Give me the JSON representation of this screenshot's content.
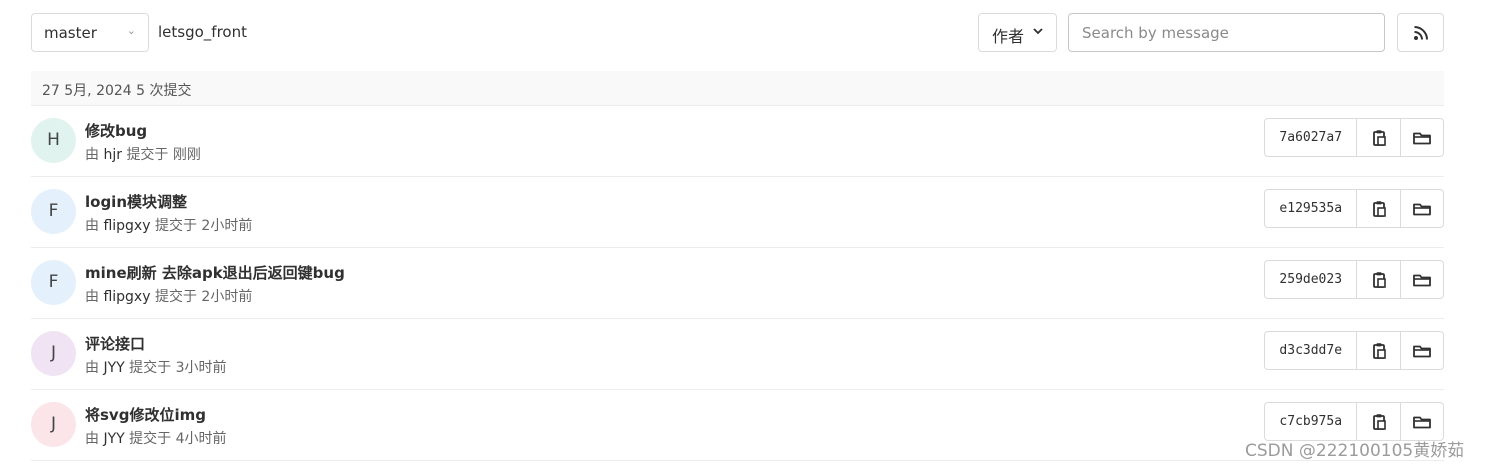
{
  "toolbar": {
    "branch": "master",
    "path": "letsgo_front",
    "author_label": "作者",
    "search_placeholder": "Search by message"
  },
  "day_header": "27 5月, 2024 5 次提交",
  "commits": [
    {
      "initial": "H",
      "avatar_color": "#e0f3ef",
      "title": "修改bug",
      "by": "由",
      "author": "hjr",
      "committed": "提交于",
      "time": "刚刚",
      "sha": "7a6027a7"
    },
    {
      "initial": "F",
      "avatar_color": "#e4f0fb",
      "title": "login模块调整",
      "by": "由",
      "author": "flipgxy",
      "committed": "提交于",
      "time": "2小时前",
      "sha": "e129535a"
    },
    {
      "initial": "F",
      "avatar_color": "#e4f0fb",
      "title": "mine刷新 去除apk退出后返回键bug",
      "by": "由",
      "author": "flipgxy",
      "committed": "提交于",
      "time": "2小时前",
      "sha": "259de023"
    },
    {
      "initial": "J",
      "avatar_color": "#efe3f4",
      "title": "评论接口",
      "by": "由",
      "author": "JYY",
      "committed": "提交于",
      "time": "3小时前",
      "sha": "d3c3dd7e"
    },
    {
      "initial": "J",
      "avatar_color": "#fbe5e8",
      "title": "将svg修改位img",
      "by": "由",
      "author": "JYY",
      "committed": "提交于",
      "time": "4小时前",
      "sha": "c7cb975a"
    }
  ],
  "watermark": "CSDN @222100105黄娇茹"
}
